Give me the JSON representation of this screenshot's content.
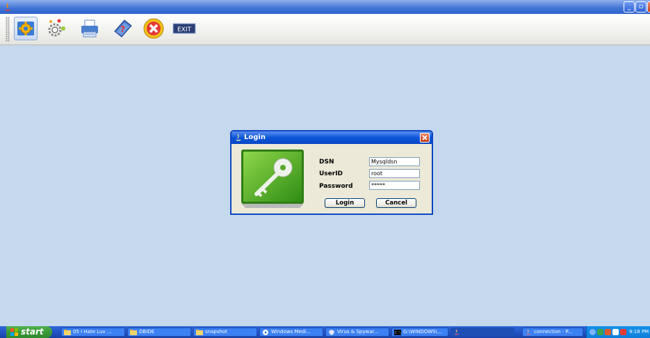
{
  "window": {
    "minimize_label": "_",
    "maximize_label": "▫",
    "close_label": "✕"
  },
  "toolbar": {
    "items": [
      {
        "name": "settings",
        "icon": "settings-icon"
      },
      {
        "name": "gears",
        "icon": "gears-icon"
      },
      {
        "name": "print",
        "icon": "printer-icon"
      },
      {
        "name": "help",
        "icon": "help-book-icon"
      },
      {
        "name": "cancel",
        "icon": "cancel-icon"
      },
      {
        "name": "exit",
        "icon": "exit-icon",
        "label": "EXIT"
      }
    ]
  },
  "dialog": {
    "title": "Login",
    "fields": {
      "dsn": {
        "label": "DSN",
        "value": "Mysqldsn"
      },
      "userid": {
        "label": "UserID",
        "value": "root"
      },
      "password": {
        "label": "Password",
        "value": "*****"
      }
    },
    "login_label": "Login",
    "cancel_label": "Cancel"
  },
  "taskbar": {
    "start_label": "start",
    "tasks": [
      {
        "label": "05 I Hate Luv ...",
        "icon": "folder-icon"
      },
      {
        "label": "DBIDE",
        "icon": "folder-icon"
      },
      {
        "label": "snapshot",
        "icon": "folder-icon"
      },
      {
        "label": "Windows Medi...",
        "icon": "media-player-icon"
      },
      {
        "label": "Virus & Spywar...",
        "icon": "shield-icon"
      },
      {
        "label": "G:\\WINDOWS\\...",
        "icon": "console-icon"
      },
      {
        "label": "",
        "icon": "java-icon"
      },
      {
        "label": "connection - P...",
        "icon": "java-icon"
      }
    ],
    "clock": "9:18 PM"
  },
  "colors": {
    "desktop": "#c6d8ee",
    "titlebar": "#2d62c9",
    "taskbar": "#2457cb",
    "start_green": "#3b9a38",
    "key_green": "#4caf2a"
  }
}
